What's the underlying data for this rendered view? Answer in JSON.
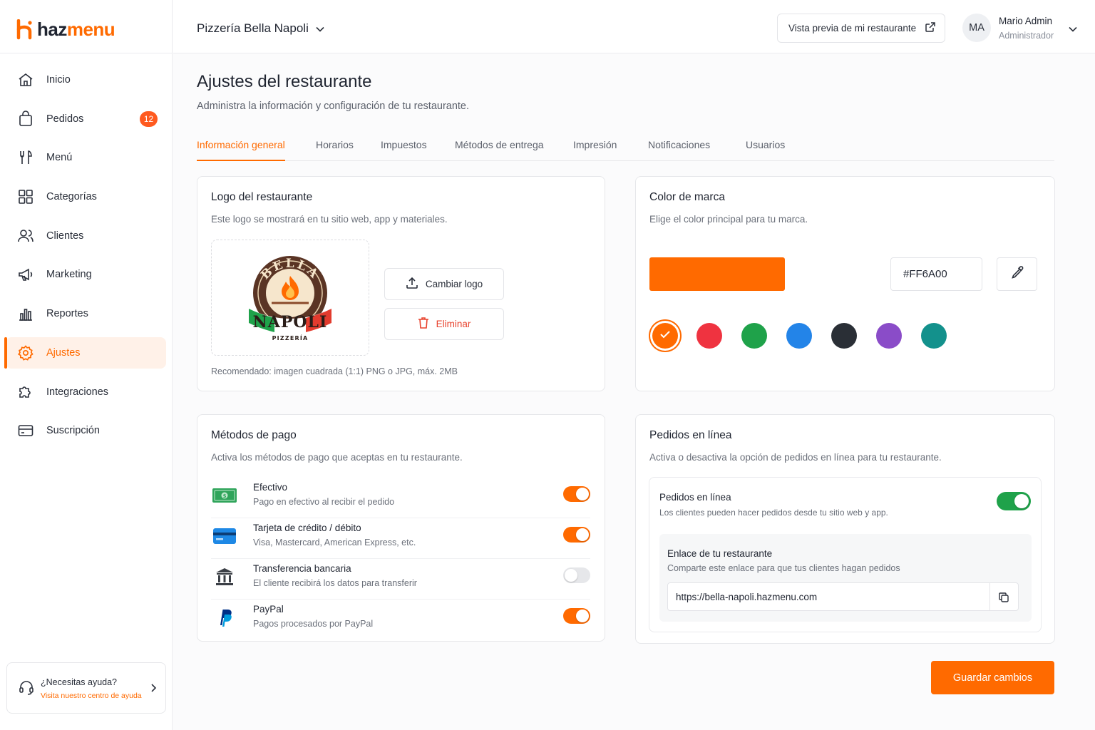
{
  "brand": {
    "part1": "haz",
    "part2": "menu",
    "accent": "#FF6A00"
  },
  "sidebar": {
    "items": [
      {
        "label": "Inicio",
        "icon": "home-icon"
      },
      {
        "label": "Pedidos",
        "icon": "shopping-bag-icon",
        "badge": "12"
      },
      {
        "label": "Menú",
        "icon": "fork-knife-icon"
      },
      {
        "label": "Categorías",
        "icon": "grid-icon"
      },
      {
        "label": "Clientes",
        "icon": "users-icon"
      },
      {
        "label": "Marketing",
        "icon": "megaphone-icon"
      },
      {
        "label": "Reportes",
        "icon": "bar-chart-icon"
      },
      {
        "label": "Ajustes",
        "icon": "gear-icon",
        "active": true
      },
      {
        "label": "Integraciones",
        "icon": "puzzle-icon"
      },
      {
        "label": "Suscripción",
        "icon": "credit-card-icon"
      }
    ],
    "help": {
      "title": "¿Necesitas ayuda?",
      "link": "Visita nuestro centro de ayuda"
    }
  },
  "topbar": {
    "restaurant": "Pizzería Bella Napoli",
    "preview_label": "Vista previa de mi restaurante",
    "user": {
      "initials": "MA",
      "name": "Mario Admin",
      "role": "Administrador"
    }
  },
  "page": {
    "title": "Ajustes del restaurante",
    "subtitle": "Administra la información y configuración de tu restaurante.",
    "tabs": [
      "Información general",
      "Horarios",
      "Impuestos",
      "Métodos de entrega",
      "Impresión",
      "Notificaciones",
      "Usuarios"
    ],
    "active_tab": "Información general"
  },
  "logo_card": {
    "title": "Logo del restaurante",
    "desc": "Este logo se mostrará en tu sitio web, app y materiales.",
    "change_label": "Cambiar logo",
    "delete_label": "Eliminar",
    "recommend": "Recomendado: imagen cuadrada (1:1) PNG o JPG, máx. 2MB",
    "logo_text": {
      "top": "BELLA",
      "middle": "NAPOLI",
      "bottom": "PIZZERÍA"
    }
  },
  "color_card": {
    "title": "Color de marca",
    "desc": "Elige el color principal para tu marca.",
    "hex": "#FF6A00",
    "swatches": [
      "#FF6A00",
      "#EF3340",
      "#1FA24A",
      "#2384E8",
      "#2A2F36",
      "#8A4CC8",
      "#13918C"
    ],
    "selected": "#FF6A00"
  },
  "payment_card": {
    "title": "Métodos de pago",
    "desc": "Activa los métodos de pago que aceptas en tu restaurante.",
    "methods": [
      {
        "name": "Efectivo",
        "desc": "Pago en efectivo al recibir el pedido",
        "enabled": true,
        "icon": "cash-icon"
      },
      {
        "name": "Tarjeta de crédito / débito",
        "desc": "Visa, Mastercard, American Express, etc.",
        "enabled": true,
        "icon": "card-icon"
      },
      {
        "name": "Transferencia bancaria",
        "desc": "El cliente recibirá los datos para transferir",
        "enabled": false,
        "icon": "bank-icon"
      },
      {
        "name": "PayPal",
        "desc": "Pagos procesados por PayPal",
        "enabled": true,
        "icon": "paypal-icon"
      }
    ]
  },
  "online_card": {
    "title": "Pedidos en línea",
    "desc": "Activa o desactiva la opción de pedidos en línea para tu restaurante.",
    "toggle_title": "Pedidos en línea",
    "toggle_desc": "Los clientes pueden hacer pedidos desde tu sitio web y app.",
    "enabled": true,
    "link_title": "Enlace de tu restaurante",
    "link_desc": "Comparte este enlace para que tus clientes hagan pedidos",
    "url": "https://bella-napoli.hazmenu.com"
  },
  "save_label": "Guardar cambios"
}
